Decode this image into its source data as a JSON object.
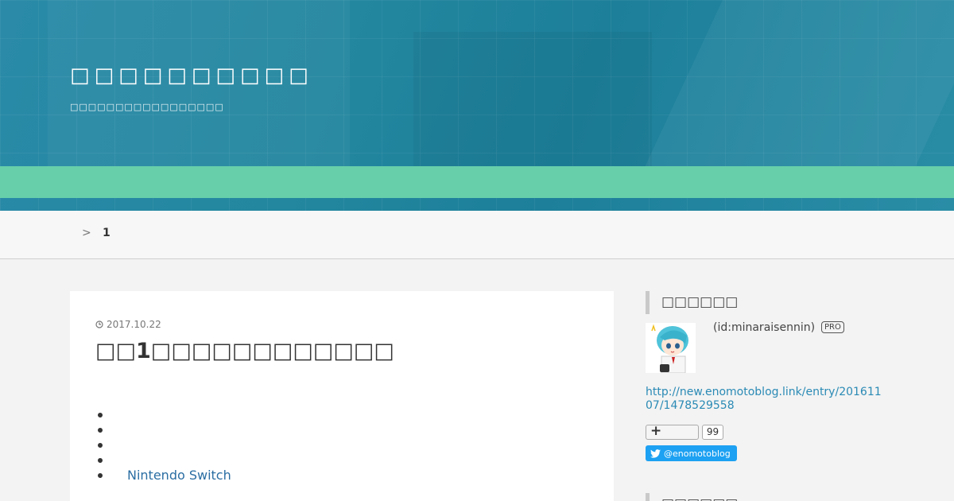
{
  "header": {
    "title": "□□□□□□□□□□",
    "description": "□□□□□□□□□□□□□□□□□"
  },
  "breadcrumb": {
    "separator": ">",
    "current": "1"
  },
  "article": {
    "date": "2017.10.22",
    "title": "□□1□□□□□□□□□□□□",
    "toc": [
      "",
      "",
      "",
      "",
      "Nintendo Switch"
    ]
  },
  "sidebar": {
    "heading": "□□□□□□",
    "user_id": "(id:minaraisennin)",
    "pro_badge": "PRO",
    "profile_link": "http://new.enomotoblog.link/entry/20161107/1478529558",
    "bookmark_icon": "+",
    "bookmark_count": "99",
    "twitter_label": "@enomotoblog",
    "heading2": "□□□□□□"
  },
  "colors": {
    "header_blue": "#23879f",
    "nav_green": "#67cfaa",
    "link_blue": "#2a8ab5",
    "twitter_blue": "#1da1f2"
  }
}
